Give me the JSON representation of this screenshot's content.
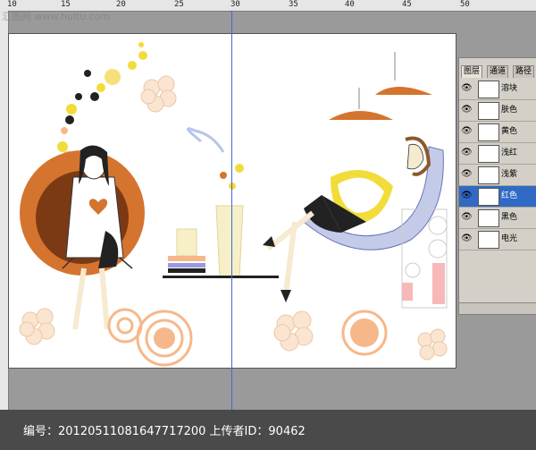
{
  "watermark": {
    "text": "汇图网 www.huitu.com"
  },
  "ruler": {
    "top_labels": [
      "10",
      "15",
      "20",
      "25",
      "30",
      "35",
      "40",
      "45",
      "50"
    ]
  },
  "layers_panel": {
    "tabs": [
      "图层",
      "通道",
      "路径"
    ],
    "active_tab": 0,
    "layers": [
      {
        "name": "溶块",
        "visible": true,
        "selected": false
      },
      {
        "name": "肤色",
        "visible": true,
        "selected": false
      },
      {
        "name": "黄色",
        "visible": true,
        "selected": false
      },
      {
        "name": "浅红",
        "visible": true,
        "selected": false
      },
      {
        "name": "浅紫",
        "visible": true,
        "selected": false
      },
      {
        "name": "红色",
        "visible": true,
        "selected": true
      },
      {
        "name": "黑色",
        "visible": true,
        "selected": false
      },
      {
        "name": "电光",
        "visible": true,
        "selected": false
      }
    ]
  },
  "caption": {
    "text": "编号：20120511081647717200 上传者ID：90462"
  },
  "colors": {
    "orange": "#d5742f",
    "brown": "#7c3a14",
    "peach": "#f6b88a",
    "yellow": "#f2dc3a",
    "cream": "#f6ead0",
    "guide": "#3d6ad6",
    "selection": "#316ac5"
  }
}
